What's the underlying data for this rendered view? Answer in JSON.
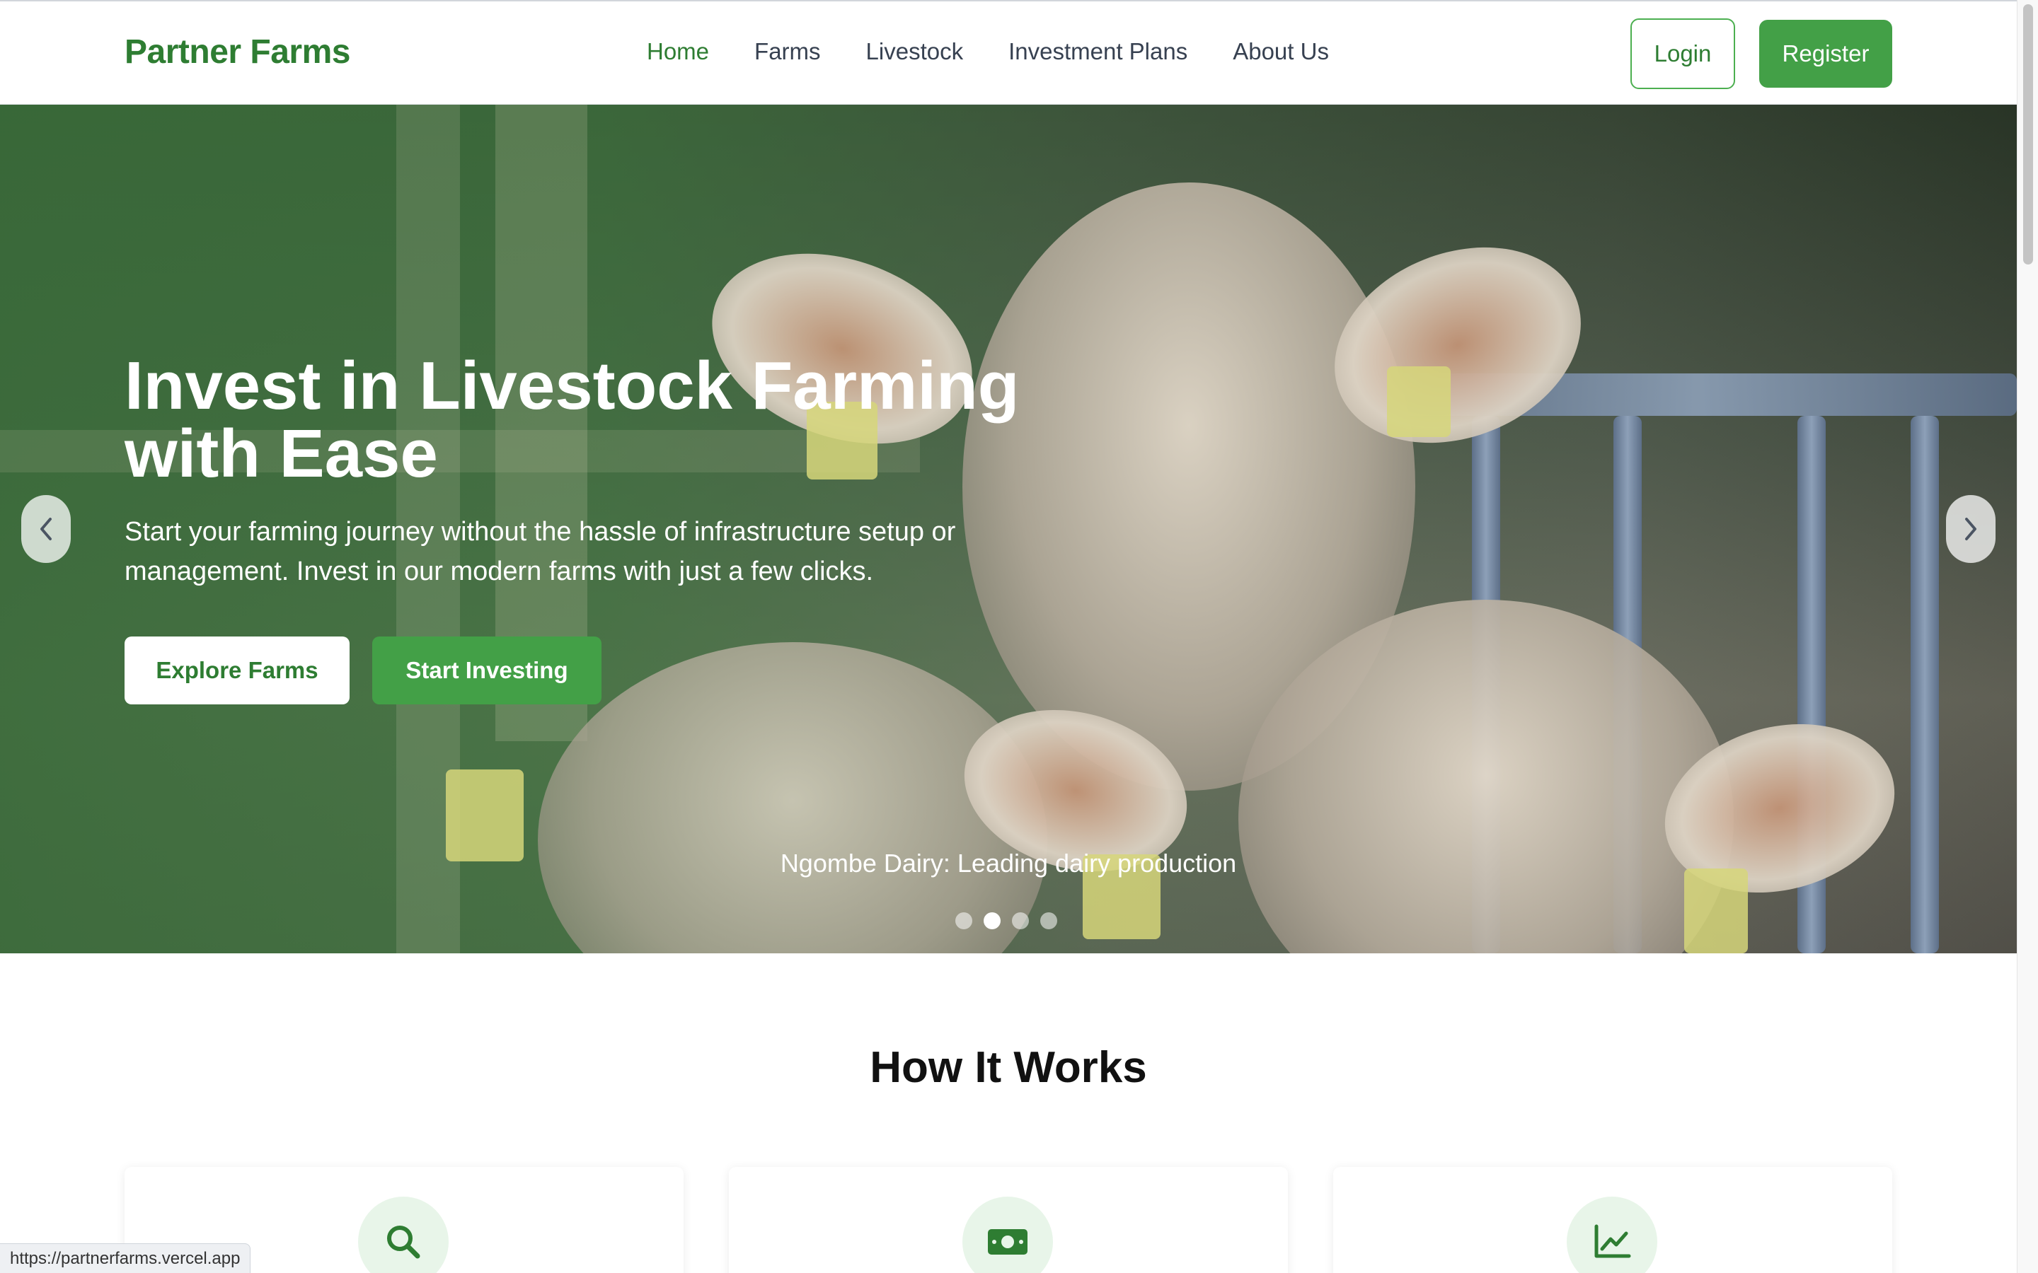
{
  "header": {
    "brand": "Partner Farms",
    "nav": [
      "Home",
      "Farms",
      "Livestock",
      "Investment Plans",
      "About Us"
    ],
    "active_nav": "Home",
    "login_label": "Login",
    "register_label": "Register"
  },
  "hero": {
    "title_line1": "Invest in Livestock Farming",
    "title_line2": "with Ease",
    "subtitle_line1": "Start your farming journey without the hassle of infrastructure setup or",
    "subtitle_line2": "management. Invest in our modern farms with just a few clicks.",
    "explore_label": "Explore Farms",
    "start_label": "Start Investing",
    "caption": "Ngombe Dairy: Leading dairy production",
    "slide_count": 4,
    "active_slide": 2,
    "prev_icon": "chevron-left-icon",
    "next_icon": "chevron-right-icon"
  },
  "how_it_works": {
    "title": "How It Works",
    "card_icons": [
      "search-icon",
      "money-icon",
      "chart-line-icon"
    ]
  },
  "status_bar": {
    "url": "https://partnerfarms.vercel.app"
  },
  "colors": {
    "brand_green": "#2e7d32",
    "button_green": "#43a047",
    "icon_bg": "#e8f5e9"
  }
}
